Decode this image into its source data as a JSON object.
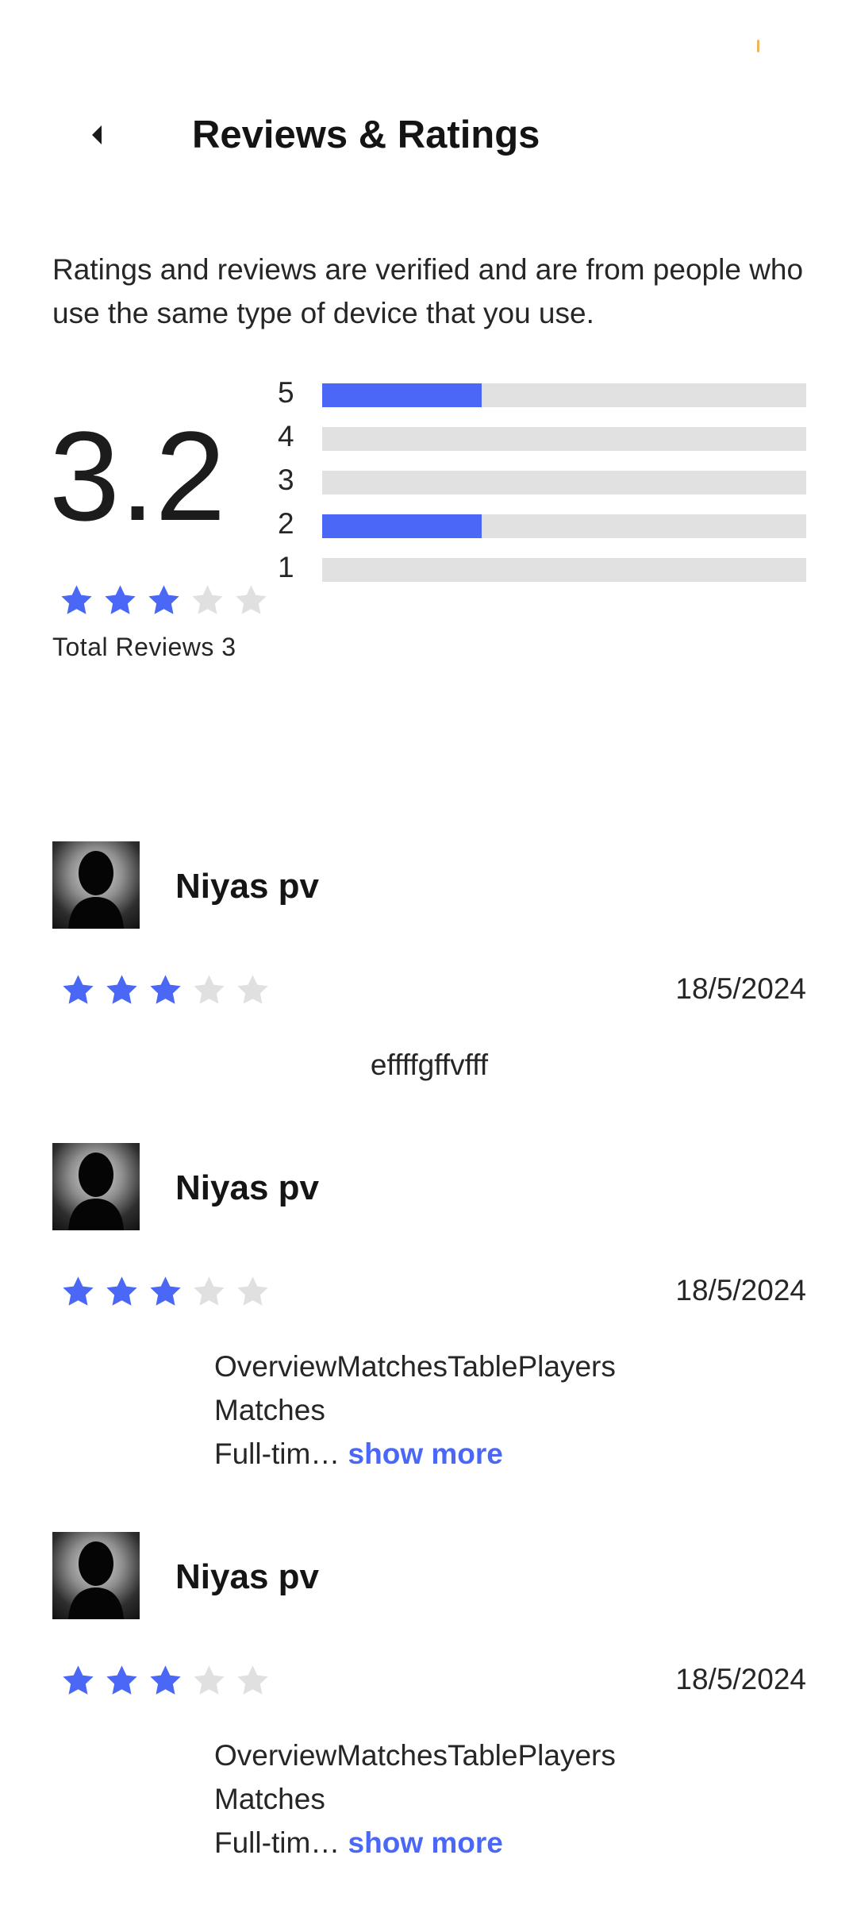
{
  "header": {
    "title": "Reviews & Ratings",
    "back_icon": "back-arrow-icon"
  },
  "intro": "Ratings and reviews are verified and are from people who use the same type of device that you use.",
  "summary": {
    "average": "3.2",
    "average_stars": 3,
    "total_reviews_label": "Total Reviews 3",
    "histogram": [
      {
        "label": "5",
        "fraction": 0.33
      },
      {
        "label": "4",
        "fraction": 0
      },
      {
        "label": "3",
        "fraction": 0
      },
      {
        "label": "2",
        "fraction": 0.33
      },
      {
        "label": "1",
        "fraction": 0
      }
    ]
  },
  "colors": {
    "accent": "#4a67f5",
    "star_empty": "#e0e0e0",
    "track": "#e1e1e1"
  },
  "reviews": [
    {
      "name": "Niyas pv",
      "date": "18/5/2024",
      "stars": 3,
      "text_lines": [
        "effffgffvfff"
      ],
      "show_more": ""
    },
    {
      "name": "Niyas pv",
      "date": "18/5/2024",
      "stars": 3,
      "text_lines": [
        "OverviewMatchesTablePlayers",
        "Matches",
        "Full-tim…"
      ],
      "show_more": "show more"
    },
    {
      "name": "Niyas pv",
      "date": "18/5/2024",
      "stars": 3,
      "text_lines": [
        "OverviewMatchesTablePlayers",
        "Matches",
        "Full-tim…"
      ],
      "show_more": "show more"
    }
  ]
}
